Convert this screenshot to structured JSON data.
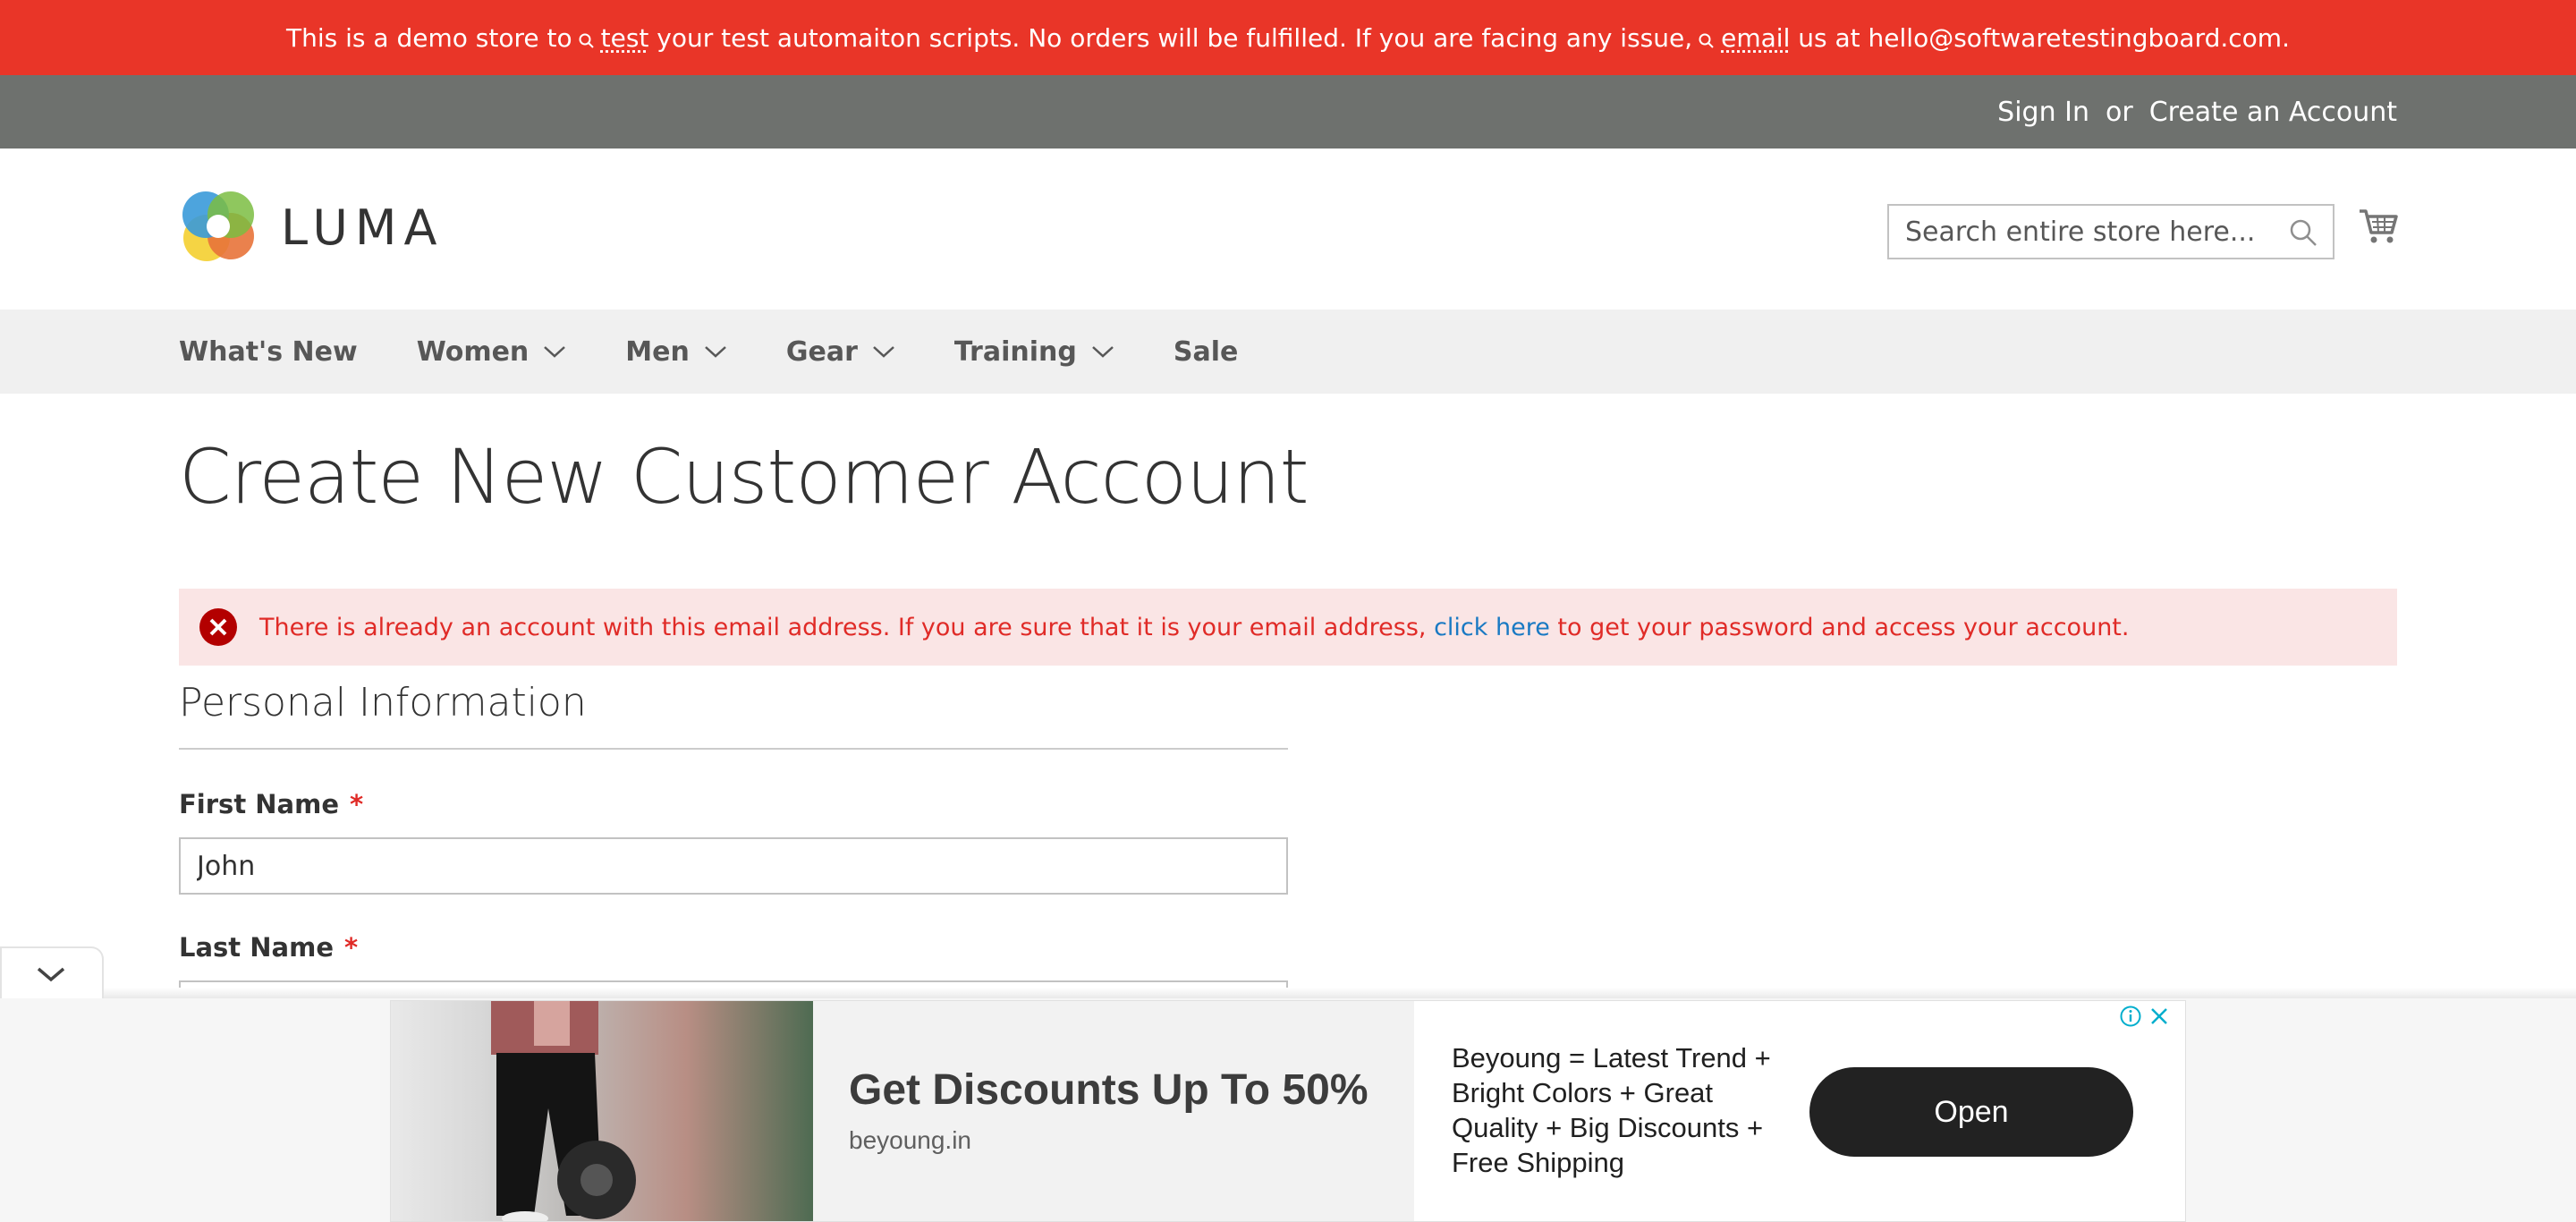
{
  "demo_banner": {
    "part1": "This is a demo store to",
    "keyword1": "test",
    "part2": "your test automaiton scripts. No orders will be fulfilled. If you are facing any issue,",
    "keyword2": "email",
    "part3": "us at hello@softwaretestingboard.com."
  },
  "header_links": {
    "sign_in": "Sign In",
    "separator": "or",
    "create_account": "Create an Account"
  },
  "logo": {
    "text": "LUMA"
  },
  "search": {
    "placeholder": "Search entire store here..."
  },
  "nav": {
    "items": [
      {
        "label": "What's New",
        "has_dropdown": false
      },
      {
        "label": "Women",
        "has_dropdown": true
      },
      {
        "label": "Men",
        "has_dropdown": true
      },
      {
        "label": "Gear",
        "has_dropdown": true
      },
      {
        "label": "Training",
        "has_dropdown": true
      },
      {
        "label": "Sale",
        "has_dropdown": false
      }
    ]
  },
  "page_title": "Create New Customer Account",
  "error_message": {
    "text_before": "There is already an account with this email address. If you are sure that it is your email address,",
    "link_text": "click here",
    "text_after": "to get your password and access your account."
  },
  "form": {
    "section_title": "Personal Information",
    "first_name": {
      "label": "First Name",
      "required_mark": "*",
      "value": "John"
    },
    "last_name": {
      "label": "Last Name",
      "required_mark": "*",
      "value": ""
    }
  },
  "ad": {
    "headline": "Get Discounts Up To 50%",
    "domain": "beyoung.in",
    "description": "Beyoung = Latest Trend + Bright Colors + Great Quality + Big Discounts + Free Shipping",
    "cta": "Open"
  },
  "colors": {
    "banner": "#e93528",
    "top_panel": "#6e716e",
    "nav_background": "#f0f0f0",
    "error_background": "#fae5e5",
    "error_text": "#e02b27",
    "link": "#1979c3",
    "ad_button": "#222222"
  }
}
